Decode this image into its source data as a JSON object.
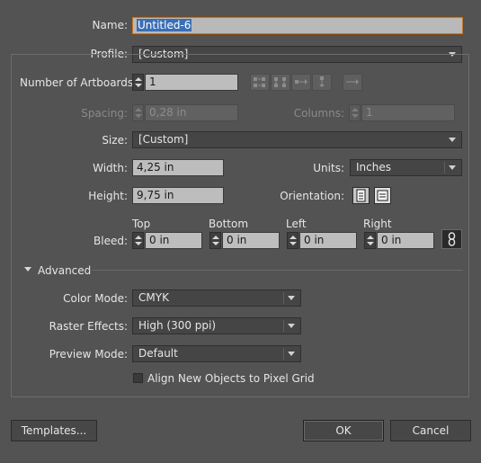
{
  "document": {
    "name_label": "Name:",
    "name_value": "Untitled-6",
    "profile_label": "Profile:",
    "profile_value": "[Custom]"
  },
  "artboards": {
    "count_label": "Number of Artboards:",
    "count_value": "1",
    "spacing_label": "Spacing:",
    "spacing_value": "0,28 in",
    "columns_label": "Columns:",
    "columns_value": "1",
    "arrange_icons": [
      "grid-by-row-icon",
      "grid-by-column-icon",
      "arrange-by-row-icon",
      "arrange-by-column-icon",
      "right-to-left-icon"
    ]
  },
  "size": {
    "size_label": "Size:",
    "size_value": "[Custom]",
    "width_label": "Width:",
    "width_value": "4,25 in",
    "height_label": "Height:",
    "height_value": "9,75 in",
    "units_label": "Units:",
    "units_value": "Inches",
    "orientation_label": "Orientation:",
    "orientation_selected": "portrait"
  },
  "bleed": {
    "label": "Bleed:",
    "top_label": "Top",
    "bottom_label": "Bottom",
    "left_label": "Left",
    "right_label": "Right",
    "top_value": "0 in",
    "bottom_value": "0 in",
    "left_value": "0 in",
    "right_value": "0 in",
    "linked": true
  },
  "advanced": {
    "section_label": "Advanced",
    "color_mode_label": "Color Mode:",
    "color_mode_value": "CMYK",
    "raster_label": "Raster Effects:",
    "raster_value": "High (300 ppi)",
    "preview_label": "Preview Mode:",
    "preview_value": "Default",
    "align_label": "Align New Objects to Pixel Grid",
    "align_checked": false
  },
  "footer": {
    "templates_label": "Templates...",
    "ok_label": "OK",
    "cancel_label": "Cancel"
  },
  "colors": {
    "background": "#535353",
    "field": "#bdbdbd",
    "focus_border": "#c07a2e",
    "selection": "#3b6fb6"
  }
}
